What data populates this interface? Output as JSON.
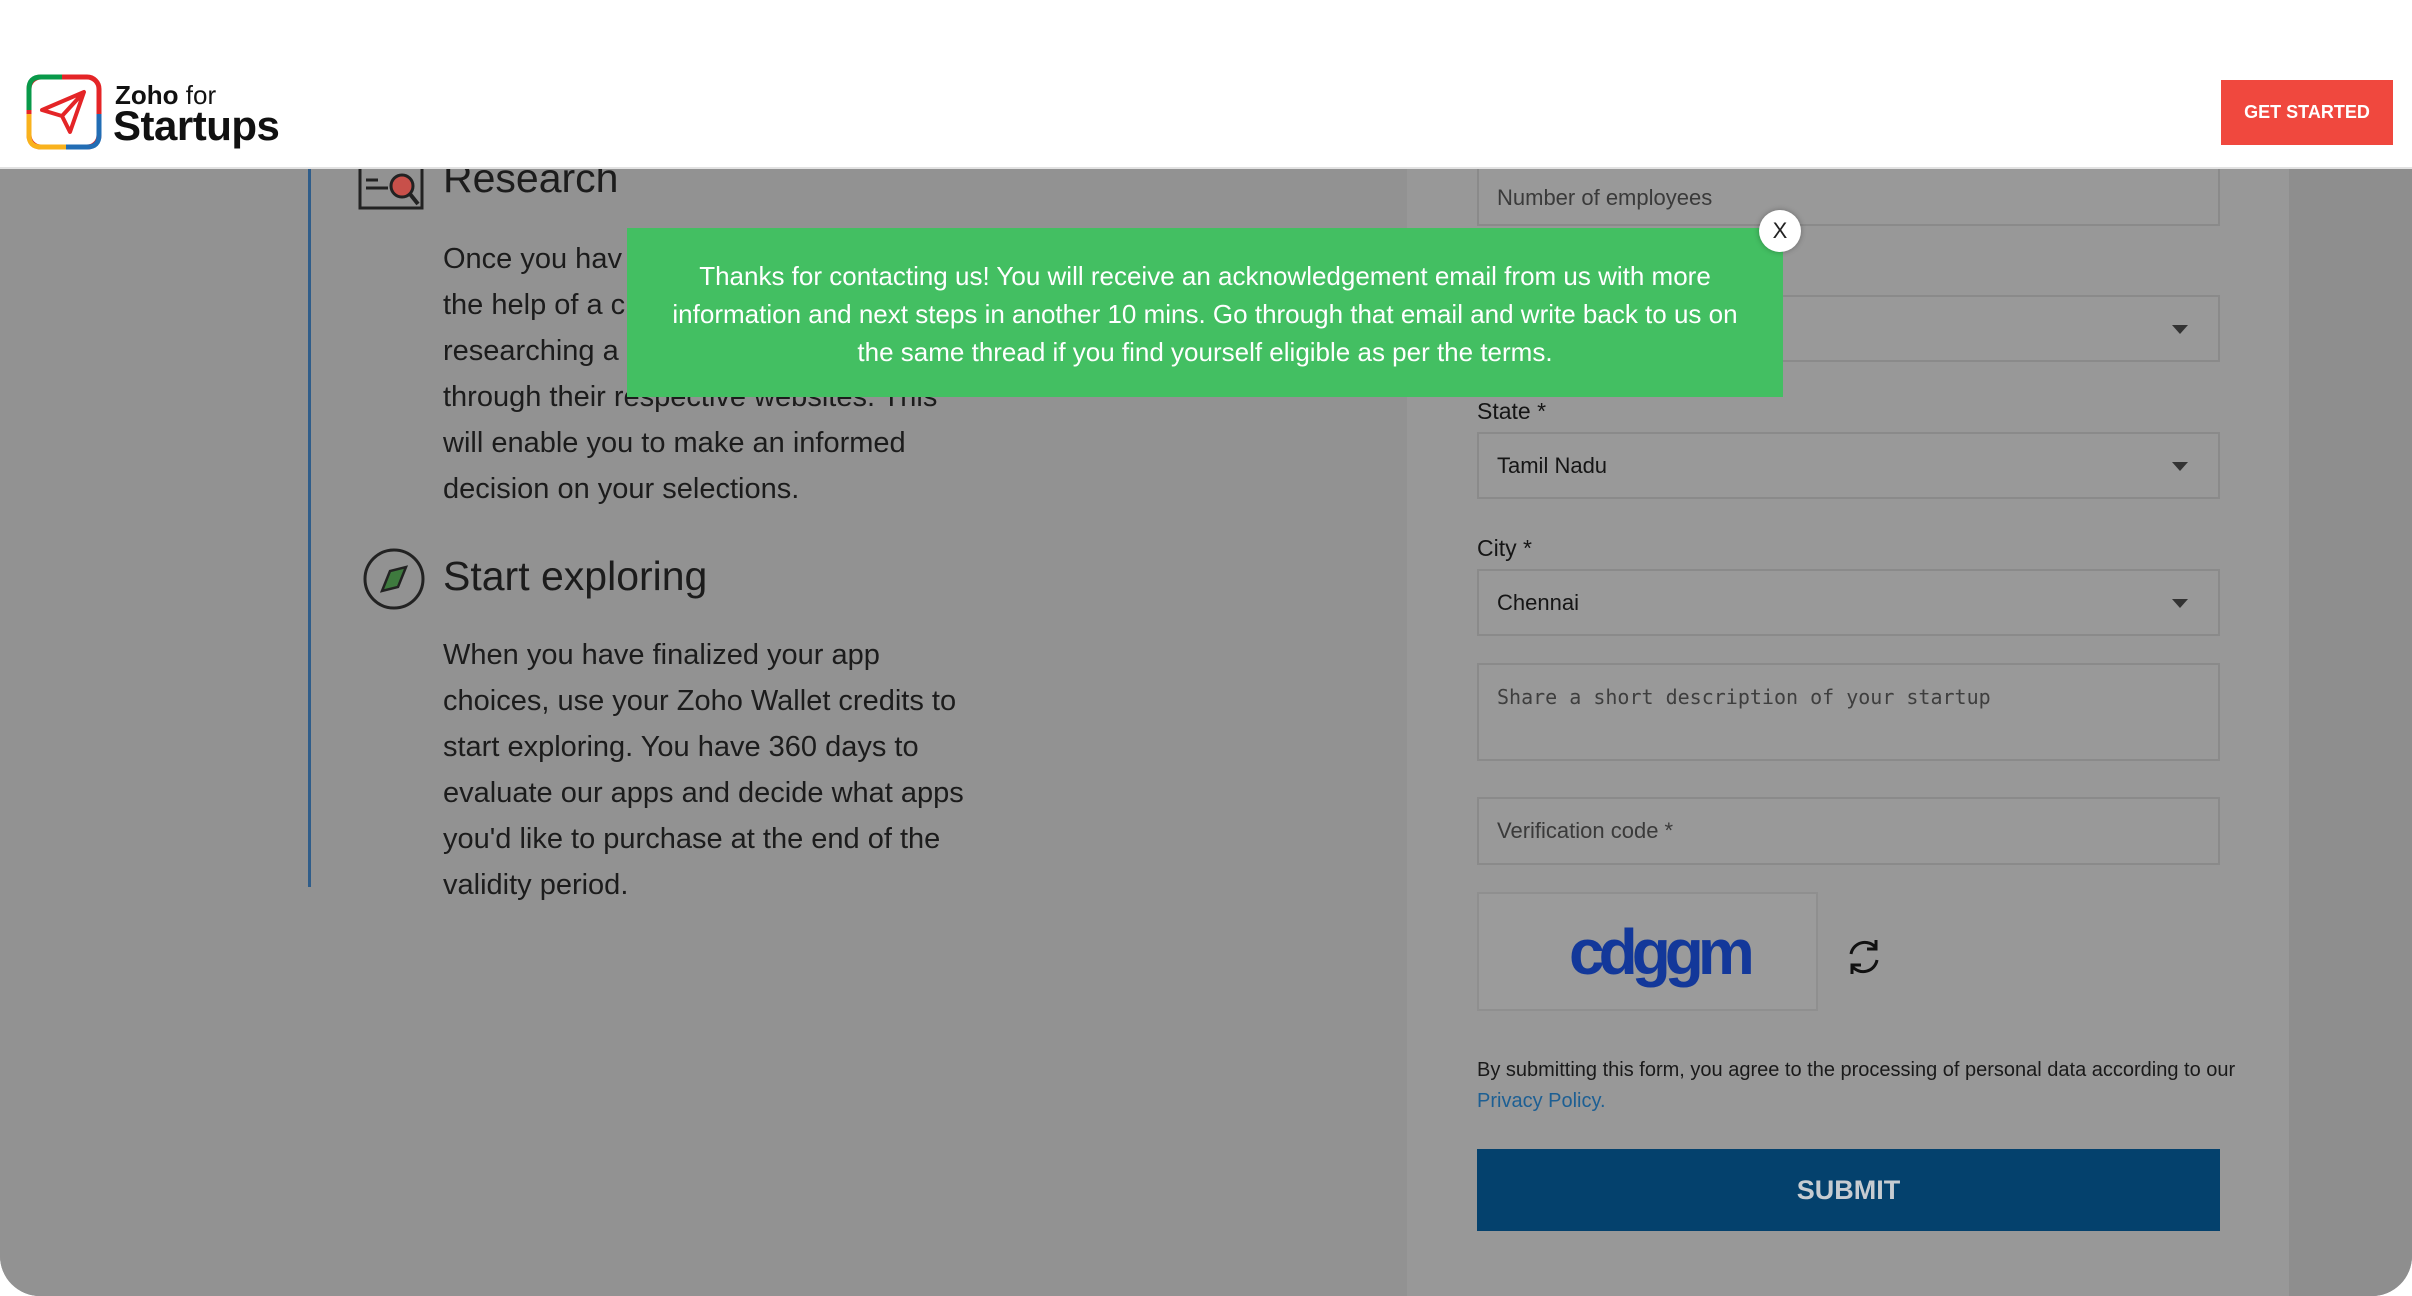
{
  "header": {
    "logo_small": "Zoho",
    "logo_for": "for",
    "logo_big": "Startups",
    "cta_label": "GET STARTED"
  },
  "colors": {
    "cta": "#f0483e",
    "toast": "#43bf62",
    "submit": "#04416d",
    "link": "#1d5f93"
  },
  "steps": [
    {
      "title": "Research",
      "icon": "research-icon",
      "lines": [
        "Once you hav",
        "the help of a c",
        "researching a",
        "through their respective websites. This",
        "will enable you to make an informed",
        "decision on your selections."
      ]
    },
    {
      "title": "Start exploring",
      "icon": "compass-icon",
      "lines": [
        "When you have finalized your app",
        "choices, use your Zoho Wallet credits to",
        "start exploring. You have 360 days to",
        "evaluate our apps and decide what apps",
        "you'd like to purchase at the end of the",
        "validity period."
      ]
    }
  ],
  "form": {
    "employees_placeholder": "Number of employees",
    "state_label": "State *",
    "state_value": "Tamil Nadu",
    "city_label": "City *",
    "city_value": "Chennai",
    "description_placeholder": "Share a short description of your startup",
    "verification_placeholder": "Verification code *",
    "captcha_text": "cdggm",
    "consent_text": "By submitting this form, you agree to the processing of personal data according to our",
    "privacy_link": "Privacy Policy.",
    "submit_label": "SUBMIT"
  },
  "toast": {
    "message": "Thanks for contacting us! You will receive an acknowledgement email from us with more information and next steps in another 10 mins. Go through that email and write back to us on the same thread if you find yourself eligible as per the terms.",
    "close_label": "X"
  }
}
